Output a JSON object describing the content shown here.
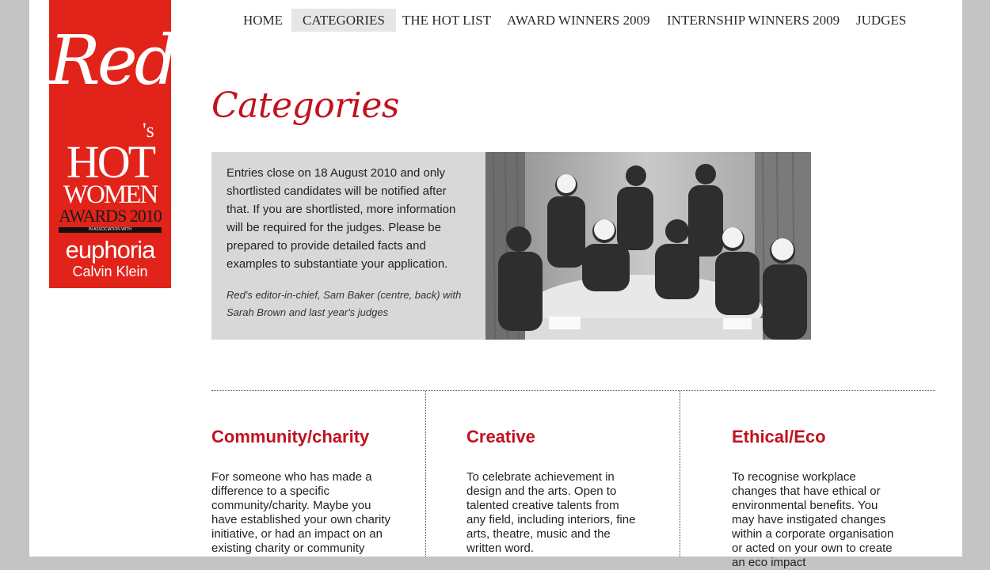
{
  "logo": {
    "script_text": "Red",
    "apostrophe_s": "'s",
    "line1": "HOT",
    "line2": "WOMEN",
    "line3": "AWARDS 2010",
    "association": "IN ASSOCIATION WITH",
    "sponsor": "euphoria",
    "sponsor_brand": "Calvin Klein",
    "bg_color": "#e2231a"
  },
  "nav": {
    "items": [
      {
        "label": "HOME"
      },
      {
        "label": "CATEGORIES",
        "active": true
      },
      {
        "label": "THE HOT LIST"
      },
      {
        "label": "AWARD WINNERS 2009"
      },
      {
        "label": "INTERNSHIP WINNERS 2009"
      },
      {
        "label": "JUDGES"
      }
    ]
  },
  "page_title": "Categories",
  "intro": {
    "text": "Entries close on 18 August 2010 and only shortlisted candidates will be notified after that. If you are shortlisted, more information will be required for the judges. Please be prepared to provide detailed facts and examples to substantiate your application.",
    "caption": "Red's editor-in-chief, Sam Baker (centre, back) with Sarah Brown and last year's judges"
  },
  "categories": [
    {
      "title": "Community/charity",
      "description": "For someone who has made a difference to a specific community/charity. Maybe you have established your own charity initiative, or had an impact on an existing charity or community"
    },
    {
      "title": "Creative",
      "description": "To celebrate achievement in design and the arts. Open to talented creative talents from any field, including interiors, fine arts, theatre, music and the written word."
    },
    {
      "title": "Ethical/Eco",
      "description": "To recognise workplace changes that have ethical or environmental benefits. You may have instigated changes within a corporate organisation or acted on your own to create an eco impact"
    }
  ],
  "colors": {
    "accent": "#c1121f",
    "page_bg": "#c4c4c4",
    "intro_bg": "#d8d8d8"
  }
}
